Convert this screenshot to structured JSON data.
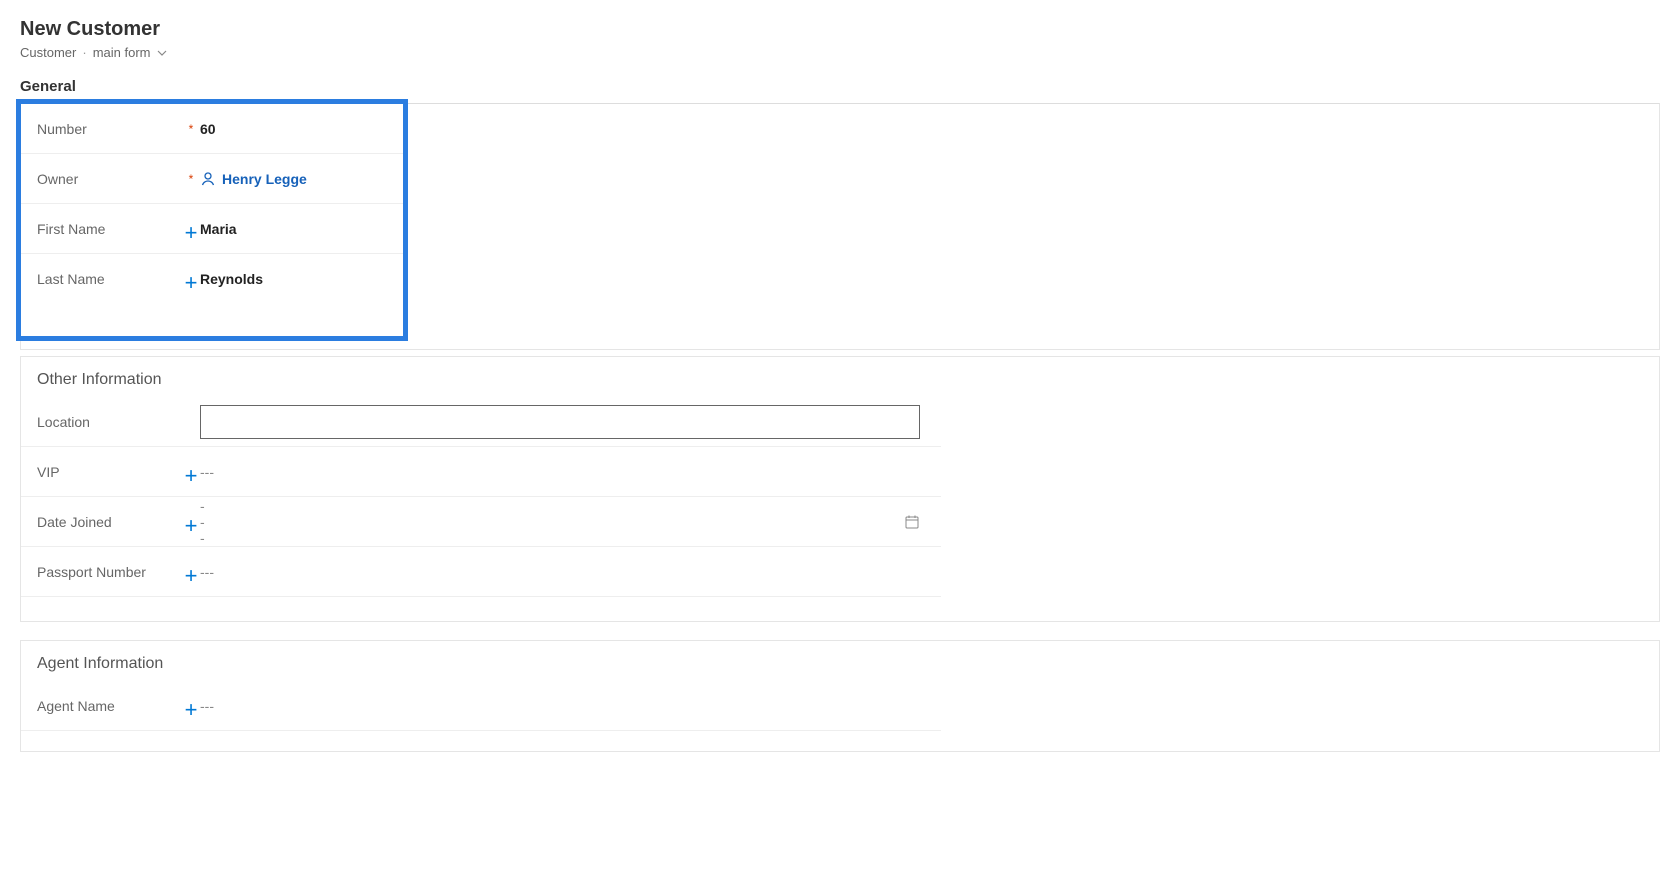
{
  "header": {
    "title": "New Customer",
    "entity": "Customer",
    "form": "main form"
  },
  "tabs": {
    "general": "General"
  },
  "general": {
    "number_label": "Number",
    "number_value": "60",
    "owner_label": "Owner",
    "owner_value": "Henry Legge",
    "first_name_label": "First Name",
    "first_name_value": "Maria",
    "last_name_label": "Last Name",
    "last_name_value": "Reynolds"
  },
  "other_info": {
    "section_title": "Other Information",
    "location_label": "Location",
    "location_value": "",
    "vip_label": "VIP",
    "vip_value": "---",
    "date_joined_label": "Date Joined",
    "date_joined_value": "---",
    "passport_label": "Passport Number",
    "passport_value": "---"
  },
  "agent_info": {
    "section_title": "Agent Information",
    "agent_name_label": "Agent Name",
    "agent_name_value": "---"
  }
}
